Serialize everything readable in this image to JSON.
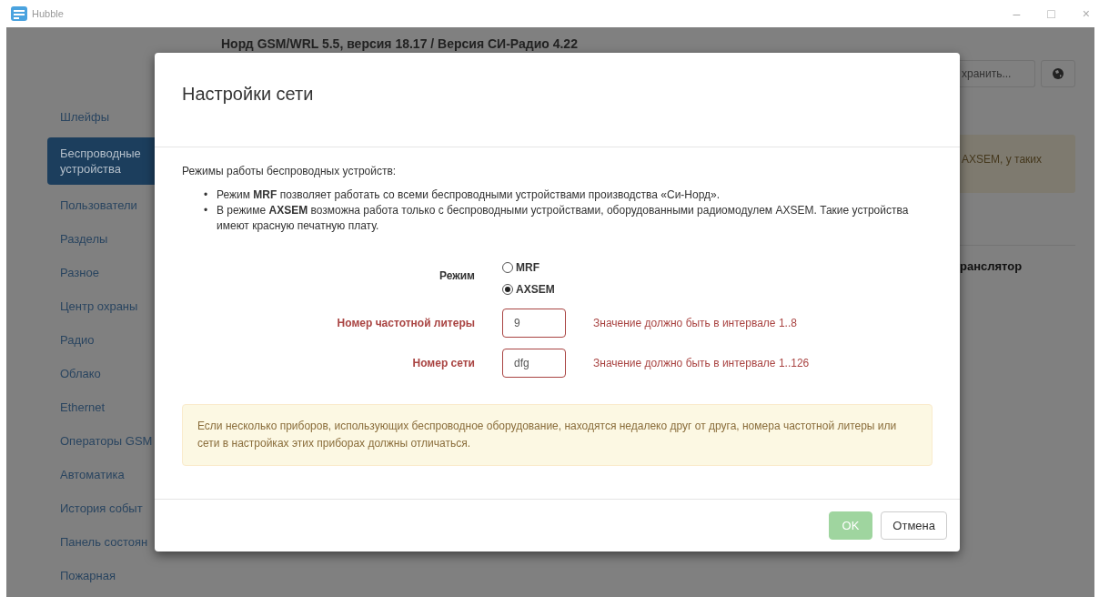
{
  "window": {
    "title": "Hubble",
    "controls": [
      "–",
      "□",
      "×"
    ]
  },
  "background": {
    "header": "Норд GSM/WRL 5.5, версия 18.17 / Версия СИ-Радио 4.22",
    "sidebar": {
      "items": [
        {
          "label": "Шлейфы",
          "selected": false
        },
        {
          "label": "Беспроводные устройства",
          "selected": true
        },
        {
          "label": "Пользователи",
          "selected": false
        },
        {
          "label": "Разделы",
          "selected": false
        },
        {
          "label": "Разное",
          "selected": false
        },
        {
          "label": "Центр охраны",
          "selected": false
        },
        {
          "label": "Радио",
          "selected": false
        },
        {
          "label": "Облако",
          "selected": false
        },
        {
          "label": "Ethernet",
          "selected": false
        },
        {
          "label": "Операторы GSM",
          "selected": false
        },
        {
          "label": "Автоматика",
          "selected": false
        },
        {
          "label": "История событ",
          "selected": false
        },
        {
          "label": "Панель состоян",
          "selected": false
        },
        {
          "label": "Пожарная",
          "selected": false
        }
      ]
    },
    "save_button": "хранить...",
    "alert": "AXSEM, у таких",
    "section_title": "ранслятор"
  },
  "dialog": {
    "title": "Настройки сети",
    "intro": "Режимы работы беспроводных устройств:",
    "bullets": [
      {
        "marker": "•",
        "text": "Режим **MRF** позволяет работать со всеми беспроводными устройствами производства «Си-Норд»."
      },
      {
        "marker": "•",
        "text": "В режиме **AXSEM** возможна работа только с беспроводными устройствами, оборудованными радиомодулем AXSEM. Такие устройства имеют красную печатную плату."
      }
    ],
    "mode": {
      "label": "Режим",
      "options": [
        {
          "label": "MRF",
          "selected": false
        },
        {
          "label": "AXSEM",
          "selected": true
        }
      ]
    },
    "fields": [
      {
        "label": "Номер частотной литеры",
        "value": "9",
        "error": true,
        "message": "Значение должно быть в интервале 1..8"
      },
      {
        "label": "Номер сети",
        "value": "dfg",
        "error": true,
        "message": "Значение должно быть в интервале 1..126"
      }
    ],
    "note": "Если несколько приборов, использующих беспроводное оборудование, находятся недалеко друг от друга, номера частотной литеры или сети в настройках этих приборах должны отличаться.",
    "buttons": [
      {
        "label": "OK",
        "kind": "primary",
        "disabled": true
      },
      {
        "label": "Отмена",
        "kind": "default",
        "disabled": false
      }
    ]
  }
}
